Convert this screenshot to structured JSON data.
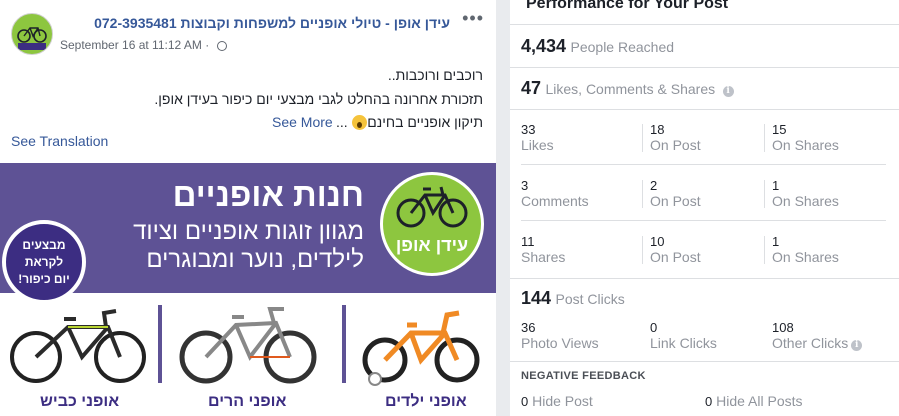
{
  "post": {
    "page_name": "עידן אופן - טיולי אופניים למשפחות וקבוצות 072-3935481",
    "timestamp": "September 16 at 11:12 AM",
    "more_icon": "more-options-icon",
    "lines": [
      "רוכבים ורוכבות..",
      "תזכורת אחרונה בהחלט לגבי מבצעי יום כיפור בעידן אופן.",
      "תיקון אופניים בחינם"
    ],
    "ellipsis": "...",
    "see_more": "See More",
    "see_translation": "See Translation",
    "image": {
      "logo_text": "עידן אופן",
      "shop_title": "חנות אופניים",
      "shop_sub_1": "מגוון זוגות אופניים וציוד",
      "shop_sub_2": "לילדים, נוער ומבוגרים",
      "promo": [
        "מבצעים",
        "לקראת",
        "יום כיפור!"
      ],
      "bike_labels": [
        "אופני כביש",
        "אופני הרים",
        "אופני ילדים"
      ]
    }
  },
  "panel": {
    "title": "Performance for Your Post",
    "reached": {
      "value": "4,434",
      "label": "People Reached"
    },
    "engagement": {
      "value": "47",
      "label": "Likes, Comments & Shares"
    },
    "rows": [
      [
        {
          "n": "33",
          "l": "Likes"
        },
        {
          "n": "18",
          "l": "On Post"
        },
        {
          "n": "15",
          "l": "On Shares"
        }
      ],
      [
        {
          "n": "3",
          "l": "Comments"
        },
        {
          "n": "2",
          "l": "On Post"
        },
        {
          "n": "1",
          "l": "On Shares"
        }
      ],
      [
        {
          "n": "11",
          "l": "Shares"
        },
        {
          "n": "10",
          "l": "On Post"
        },
        {
          "n": "1",
          "l": "On Shares"
        }
      ]
    ],
    "clicks": {
      "value": "144",
      "label": "Post Clicks"
    },
    "click_rows": [
      {
        "n": "36",
        "l": "Photo Views"
      },
      {
        "n": "0",
        "l": "Link Clicks"
      },
      {
        "n": "108",
        "l": "Other Clicks"
      }
    ],
    "negative_title": "NEGATIVE FEEDBACK",
    "negative": [
      {
        "n": "0",
        "l": "Hide Post"
      },
      {
        "n": "0",
        "l": "Hide All Posts"
      }
    ]
  },
  "colors": {
    "link": "#365899",
    "banner": "#5e5295",
    "logo_green": "#8dc63f"
  }
}
